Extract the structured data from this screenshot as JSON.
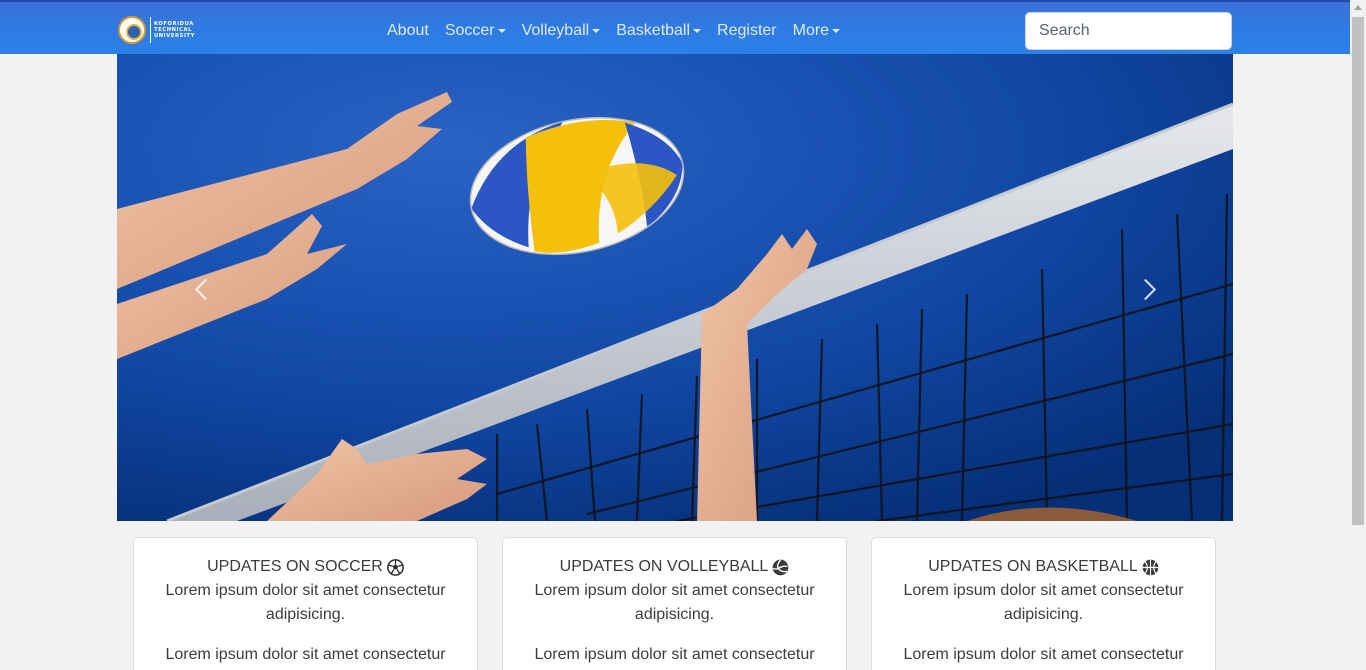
{
  "navbar": {
    "brand": {
      "lines": [
        "KOFORIDUA",
        "TECHNICAL",
        "UNIVERSITY"
      ]
    },
    "links": [
      {
        "label": "About",
        "dropdown": false
      },
      {
        "label": "Soccer",
        "dropdown": true
      },
      {
        "label": "Volleyball",
        "dropdown": true
      },
      {
        "label": "Basketball",
        "dropdown": true
      },
      {
        "label": "Register",
        "dropdown": false
      },
      {
        "label": "More",
        "dropdown": true
      }
    ],
    "search": {
      "placeholder": "Search",
      "value": ""
    }
  },
  "carousel": {
    "image": "volleyball-at-net",
    "controls": {
      "prev_icon": "chevron-left-icon",
      "next_icon": "chevron-right-icon"
    }
  },
  "cards": [
    {
      "title": "UPDATES ON SOCCER",
      "icon": "soccer-ball-icon",
      "paragraphs": [
        "Lorem ipsum dolor sit amet consectetur adipisicing.",
        "Lorem ipsum dolor sit amet consectetur"
      ]
    },
    {
      "title": "UPDATES ON VOLLEYBALL",
      "icon": "volleyball-icon",
      "paragraphs": [
        "Lorem ipsum dolor sit amet consectetur adipisicing.",
        "Lorem ipsum dolor sit amet consectetur"
      ]
    },
    {
      "title": "UPDATES ON BASKETBALL",
      "icon": "basketball-icon",
      "paragraphs": [
        "Lorem ipsum dolor sit amet consectetur adipisicing.",
        "Lorem ipsum dolor sit amet consectetur"
      ]
    }
  ],
  "colors": {
    "navbar": "#2c80e6",
    "page_background": "#f2f2f2",
    "card_background": "#ffffff"
  }
}
